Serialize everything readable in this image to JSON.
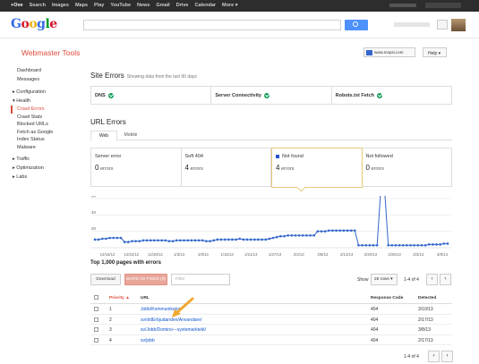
{
  "topbar": {
    "links": [
      "+Ove",
      "Search",
      "Images",
      "Maps",
      "Play",
      "YouTube",
      "News",
      "Gmail",
      "Drive",
      "Calendar",
      "More ▾"
    ]
  },
  "brand": {
    "logo_letters": [
      "G",
      "o",
      "o",
      "g",
      "l",
      "e"
    ],
    "product": "Webmaster Tools"
  },
  "header": {
    "site_selector": "www.mopsi.com",
    "help_label": "Help ▾"
  },
  "sidebar": {
    "items": [
      {
        "label": "Dashboard",
        "type": "item"
      },
      {
        "label": "Messages",
        "type": "item"
      },
      {
        "label": "▸ Configuration",
        "type": "section"
      },
      {
        "label": "▾ Health",
        "type": "section"
      },
      {
        "label": "Crawl Errors",
        "type": "sub",
        "active": true
      },
      {
        "label": "Crawl Stats",
        "type": "sub"
      },
      {
        "label": "Blocked URLs",
        "type": "sub"
      },
      {
        "label": "Fetch as Google",
        "type": "sub"
      },
      {
        "label": "Index Status",
        "type": "sub"
      },
      {
        "label": "Malware",
        "type": "sub"
      },
      {
        "label": "▸ Traffic",
        "type": "section"
      },
      {
        "label": "▸ Optimization",
        "type": "section"
      },
      {
        "label": "▸ Labs",
        "type": "section"
      }
    ]
  },
  "site_errors": {
    "title": "Site Errors",
    "subtitle": "Showing data from the last 90 days",
    "items": [
      "DNS",
      "Server Connectivity",
      "Robots.txt Fetch"
    ]
  },
  "url_errors": {
    "title": "URL Errors",
    "tabs": [
      "Web",
      "Mobile"
    ],
    "cards": [
      {
        "title": "Server error",
        "count": "0",
        "unit": "errors"
      },
      {
        "title": "Soft 404",
        "count": "4",
        "unit": "errors"
      },
      {
        "title": "Not found",
        "count": "4",
        "unit": "errors",
        "selected": true
      },
      {
        "title": "Not followed",
        "count": "0",
        "unit": "errors"
      }
    ]
  },
  "chart_data": {
    "type": "line",
    "title": "",
    "xlabel": "",
    "ylabel": "",
    "ylim": [
      0,
      60
    ],
    "y_ticks": [
      20,
      40,
      60
    ],
    "x_tick_labels": [
      "12/16/12",
      "12/22/12",
      "12/28/12",
      "1/3/13",
      "1/9/13",
      "1/15/13",
      "1/21/13",
      "1/27/13",
      "2/2/13",
      "2/8/13",
      "2/14/13",
      "2/20/13",
      "2/25/13",
      "3/3/13",
      "3/9/13"
    ],
    "series": [
      {
        "color": "#3366cc",
        "values": [
          10,
          10,
          11,
          11,
          12,
          12,
          12,
          12,
          7,
          7,
          8,
          8,
          8,
          9,
          9,
          9,
          9,
          9,
          9,
          9,
          8,
          8,
          9,
          9,
          9,
          9,
          9,
          9,
          9,
          9,
          8,
          8,
          9,
          10,
          10,
          10,
          10,
          10,
          10,
          11,
          10,
          10,
          10,
          10,
          10,
          10,
          10,
          11,
          12,
          13,
          14,
          14,
          15,
          15,
          15,
          15,
          15,
          15,
          15,
          15,
          20,
          20,
          20,
          21,
          21,
          21,
          21,
          21,
          21,
          21,
          21,
          3,
          3,
          3,
          3,
          3,
          3,
          72,
          72,
          3,
          3,
          3,
          3,
          3,
          3,
          3,
          3,
          3,
          3,
          3,
          4,
          4,
          4,
          4,
          5,
          5
        ]
      }
    ]
  },
  "table_section": {
    "title": "Top 1,000 pages with errors",
    "download_label": "Download",
    "mark_fixed_label": "MARK AS FIXED (0)",
    "filter_placeholder": "Filter",
    "show_label": "Show",
    "rows_selected": "25 rows ▾",
    "page_info": "1-4 of 4",
    "prev": "‹",
    "next": "›",
    "headers": {
      "priority": "Priority ▲",
      "url": "URL",
      "code": "Response Code",
      "detected": "Detected"
    },
    "rows": [
      {
        "priority": "1",
        "url": "Jobb/Kommunikator/",
        "code": "404",
        "detected": "3/10/13"
      },
      {
        "priority": "2",
        "url": "sv/oldErbjudanden/Anvandare/",
        "code": "404",
        "detected": "2/17/13"
      },
      {
        "priority": "3",
        "url": "sv/Jobb/Domino---systemarktekt/",
        "code": "404",
        "detected": "3/8/13"
      },
      {
        "priority": "4",
        "url": "sv/jobb",
        "code": "404",
        "detected": "2/17/13"
      }
    ]
  },
  "colors": {
    "accent_red": "#dd4b39",
    "link_blue": "#1155cc",
    "ok_green": "#0f9d58",
    "chart_blue": "#3366cc",
    "annotation_arrow": "#f0a830"
  }
}
